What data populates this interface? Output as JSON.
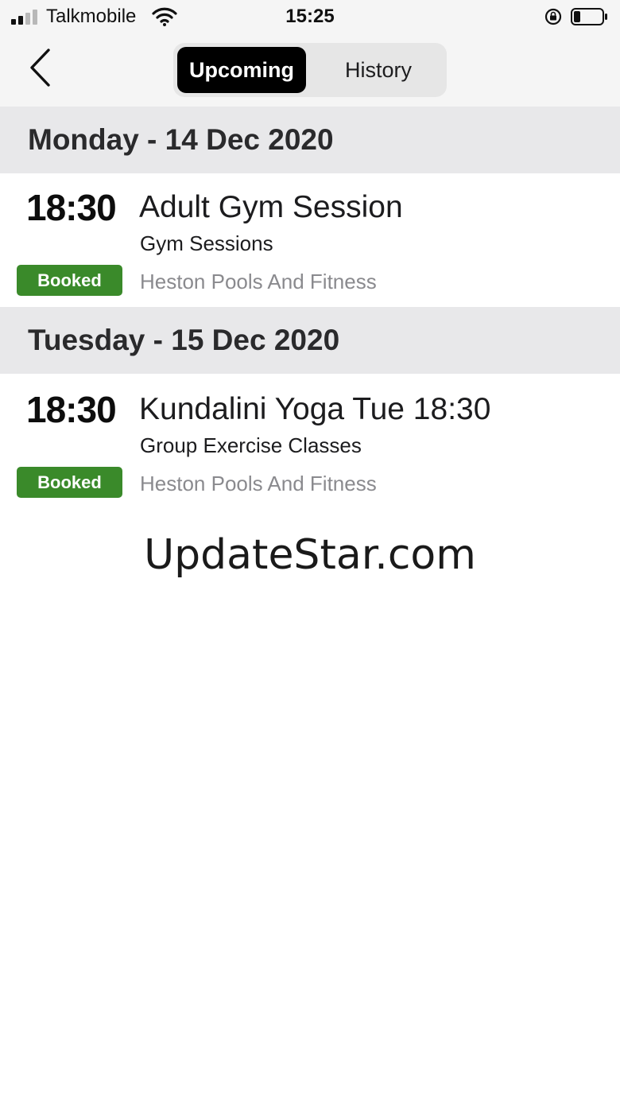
{
  "status_bar": {
    "carrier": "Talkmobile",
    "time": "15:25",
    "signal_bars": 2,
    "battery_level": 0.2,
    "icons": [
      "signal-icon",
      "wifi-icon",
      "rotation-lock-icon",
      "battery-icon"
    ]
  },
  "nav": {
    "back_icon": "chevron-left-icon",
    "tabs": [
      {
        "label": "Upcoming",
        "selected": true
      },
      {
        "label": "History",
        "selected": false
      }
    ]
  },
  "days": [
    {
      "header": "Monday - 14 Dec 2020",
      "bookings": [
        {
          "time": "18:30",
          "title": "Adult Gym Session",
          "category": "Gym Sessions",
          "status": "Booked",
          "venue": "Heston Pools And Fitness"
        }
      ]
    },
    {
      "header": "Tuesday - 15 Dec 2020",
      "bookings": [
        {
          "time": "18:30",
          "title": "Kundalini Yoga Tue 18:30",
          "category": "Group Exercise Classes",
          "status": "Booked",
          "venue": "Heston Pools And Fitness"
        }
      ]
    }
  ],
  "watermark": "UpdateStar.com",
  "colors": {
    "booked_badge": "#3a8a2a",
    "header_bg": "#e8e8ea",
    "selected_tab_bg": "#000000",
    "venue_text": "#8a8a8e"
  }
}
